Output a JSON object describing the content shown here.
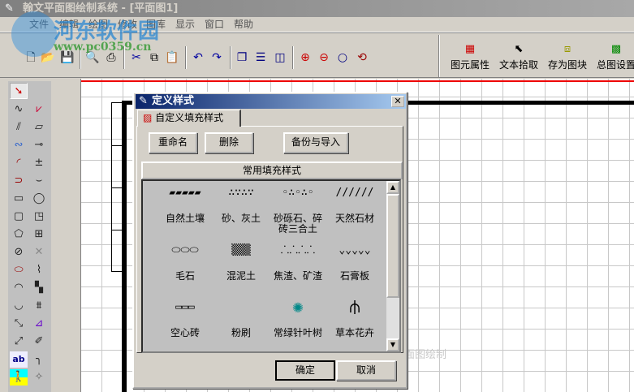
{
  "window": {
    "title": "翰文平面图绘制系统 - [平面图1]"
  },
  "watermark": {
    "brand": "河东软件园",
    "url": "www.pc0359.cn"
  },
  "menu": [
    "文件",
    "编辑",
    "绘图",
    "修改",
    "图库",
    "显示",
    "窗口",
    "帮助"
  ],
  "toolbar": {
    "icons": [
      "new-icon",
      "open-icon",
      "save-icon",
      "print-preview-icon",
      "print-icon",
      "cut-icon",
      "copy-icon",
      "paste-icon",
      "undo-icon",
      "redo-icon",
      "cascade-icon",
      "tile-horizontal-icon",
      "tile-vertical-icon",
      "zoom-in-icon",
      "zoom-out-icon",
      "zoom-icon",
      "zoom-refresh-icon"
    ],
    "big_buttons": [
      {
        "label": "图元属性"
      },
      {
        "label": "文本拾取"
      },
      {
        "label": "存为图块"
      },
      {
        "label": "总图设置"
      }
    ]
  },
  "canvas": {
    "background_text": "平面图绘制"
  },
  "dialog": {
    "title": "定义样式",
    "tab": "自定义填充样式",
    "buttons": {
      "rename": "重命名",
      "delete": "删除",
      "backup": "备份与导入"
    },
    "list_header": "常用填充样式",
    "items": [
      {
        "name": "自然土壤",
        "pat": "▰▰▰▰▰"
      },
      {
        "name": "砂、灰土",
        "pat": "∴∵∴∵"
      },
      {
        "name": "砂砾石、碎砖三合土",
        "pat": "◦∴◦∴◦"
      },
      {
        "name": "天然石材",
        "pat": "//////"
      },
      {
        "name": "毛石",
        "pat": "⬭⬭⬭"
      },
      {
        "name": "混泥土",
        "pat": "▒▒▒"
      },
      {
        "name": "焦渣、矿渣",
        "pat": "⸫⸫⸫⸫"
      },
      {
        "name": "石膏板",
        "pat": "⌄⌄⌄⌄⌄"
      },
      {
        "name": "空心砖",
        "pat": "▭▭▭"
      },
      {
        "name": "粉刷",
        "pat": ""
      },
      {
        "name": "常绿针叶树",
        "pat": "✺"
      },
      {
        "name": "草本花卉",
        "pat": "⫛"
      }
    ],
    "ok": "确定",
    "cancel": "取消"
  },
  "colors": {
    "dialog_title_start": "#0a246a",
    "dialog_title_end": "#a6caf0",
    "list_bg": "#c0c0c0"
  }
}
